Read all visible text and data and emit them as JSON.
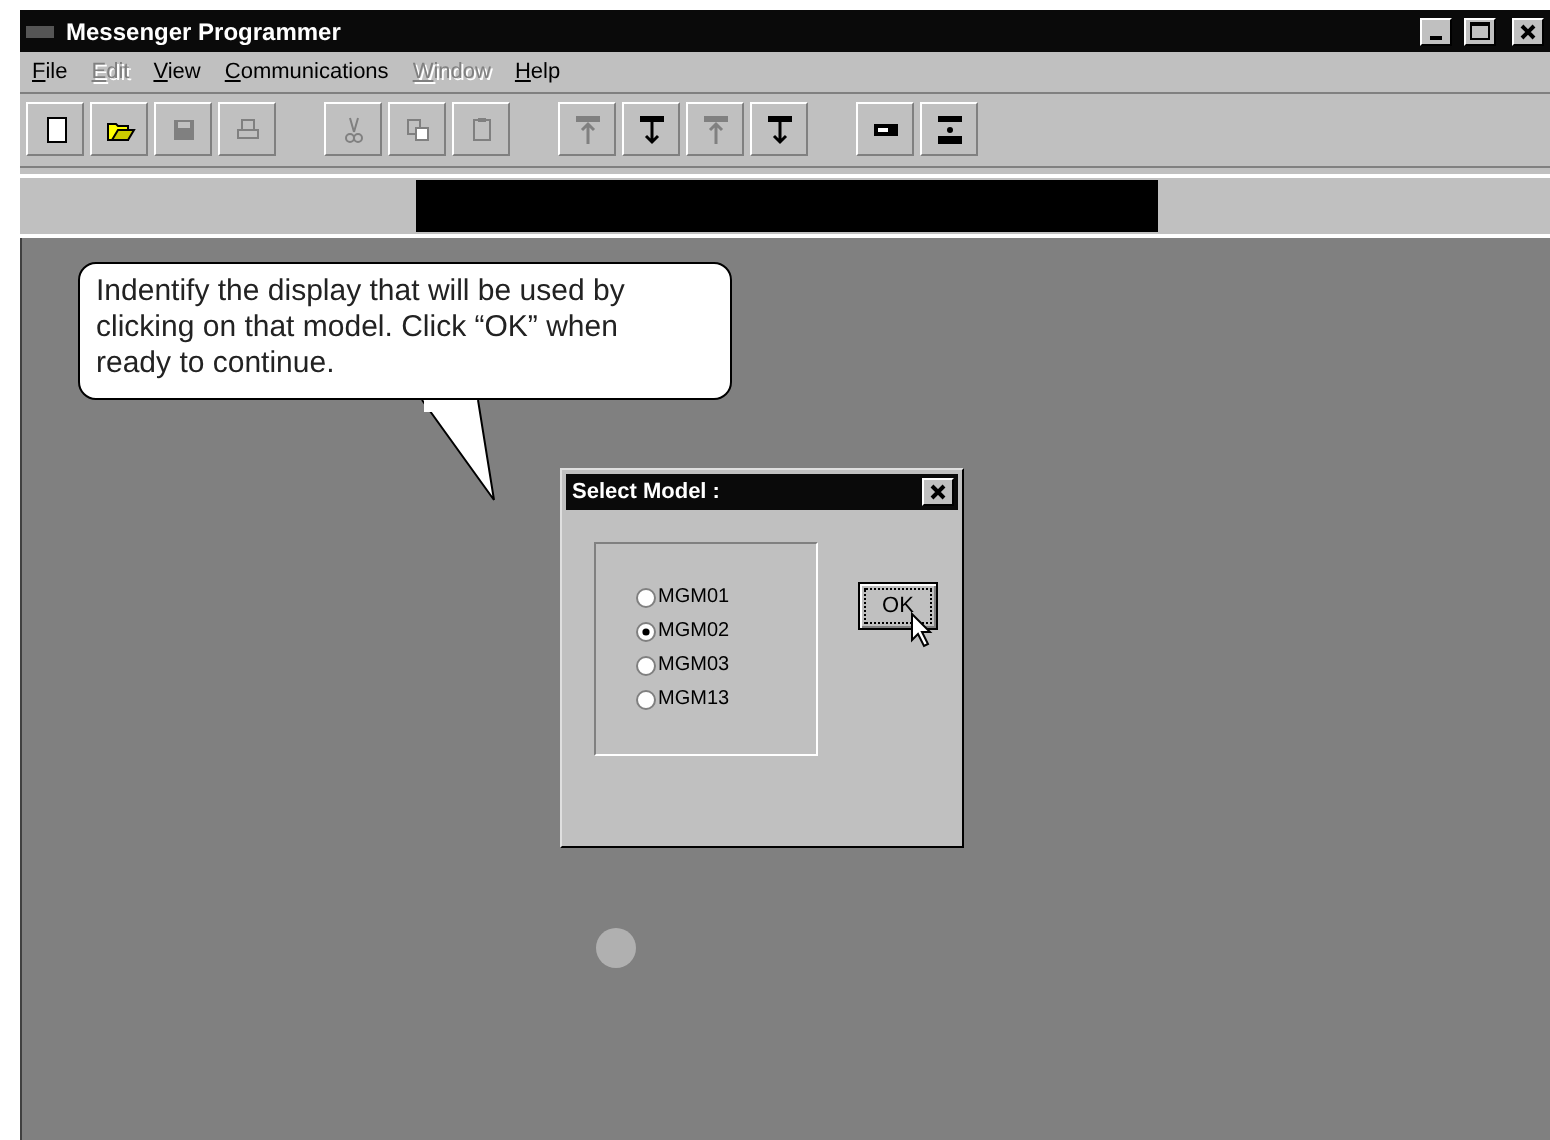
{
  "window": {
    "title": "Messenger Programmer"
  },
  "menu": [
    {
      "label": "File",
      "disabled": false
    },
    {
      "label": "Edit",
      "disabled": true
    },
    {
      "label": "View",
      "disabled": false
    },
    {
      "label": "Communications",
      "disabled": false
    },
    {
      "label": "Window",
      "disabled": true
    },
    {
      "label": "Help",
      "disabled": false
    }
  ],
  "toolbar": [
    {
      "kind": "new",
      "disabled": false
    },
    {
      "kind": "open",
      "disabled": false
    },
    {
      "kind": "save",
      "disabled": true
    },
    {
      "kind": "print",
      "disabled": true
    },
    {
      "kind": "separator"
    },
    {
      "kind": "cut",
      "disabled": true
    },
    {
      "kind": "copy",
      "disabled": true
    },
    {
      "kind": "paste",
      "disabled": true
    },
    {
      "kind": "separator"
    },
    {
      "kind": "upload",
      "disabled": true
    },
    {
      "kind": "download",
      "disabled": false
    },
    {
      "kind": "upload",
      "disabled": true
    },
    {
      "kind": "download",
      "disabled": false
    },
    {
      "kind": "separator"
    },
    {
      "kind": "display",
      "disabled": false
    },
    {
      "kind": "query",
      "disabled": false
    }
  ],
  "callout": {
    "text": "Indentify the display that will be used by clicking on that model. Click “OK” when ready to continue."
  },
  "dialog": {
    "title": "Select Model :",
    "options": [
      {
        "label": "MGM01",
        "selected": false
      },
      {
        "label": "MGM02",
        "selected": true
      },
      {
        "label": "MGM03",
        "selected": false
      },
      {
        "label": "MGM13",
        "selected": false
      }
    ],
    "ok": "OK"
  }
}
